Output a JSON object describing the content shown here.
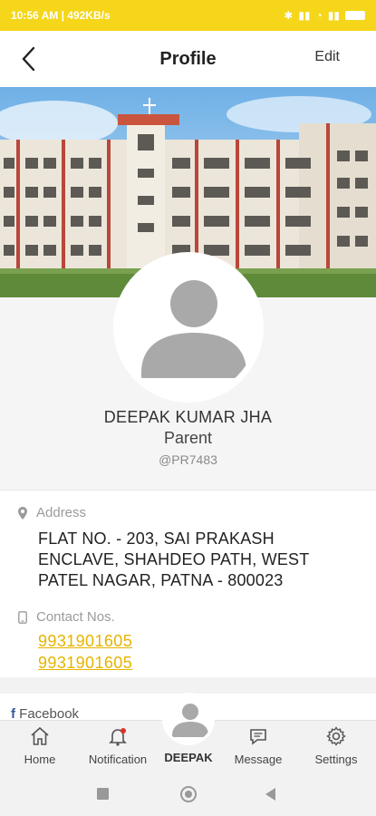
{
  "status": {
    "left": "10:56 AM | 492KB/s",
    "battery": "65"
  },
  "header": {
    "title": "Profile",
    "edit": "Edit"
  },
  "profile": {
    "name": "DEEPAK KUMAR JHA",
    "role": "Parent",
    "id": "@PR7483"
  },
  "address": {
    "label": "Address",
    "value": "FLAT NO. - 203, SAI PRAKASH ENCLAVE, SHAHDEO PATH, WEST PATEL NAGAR, PATNA - 800023"
  },
  "contact": {
    "label": "Contact Nos.",
    "numbers": [
      "9931901605",
      "9931901605"
    ]
  },
  "facebook": {
    "label": "Facebook"
  },
  "nav": {
    "home": "Home",
    "notification": "Notification",
    "center": "DEEPAK",
    "message": "Message",
    "settings": "Settings"
  },
  "colors": {
    "accent": "#f5d61a",
    "phone": "#e6b400"
  }
}
